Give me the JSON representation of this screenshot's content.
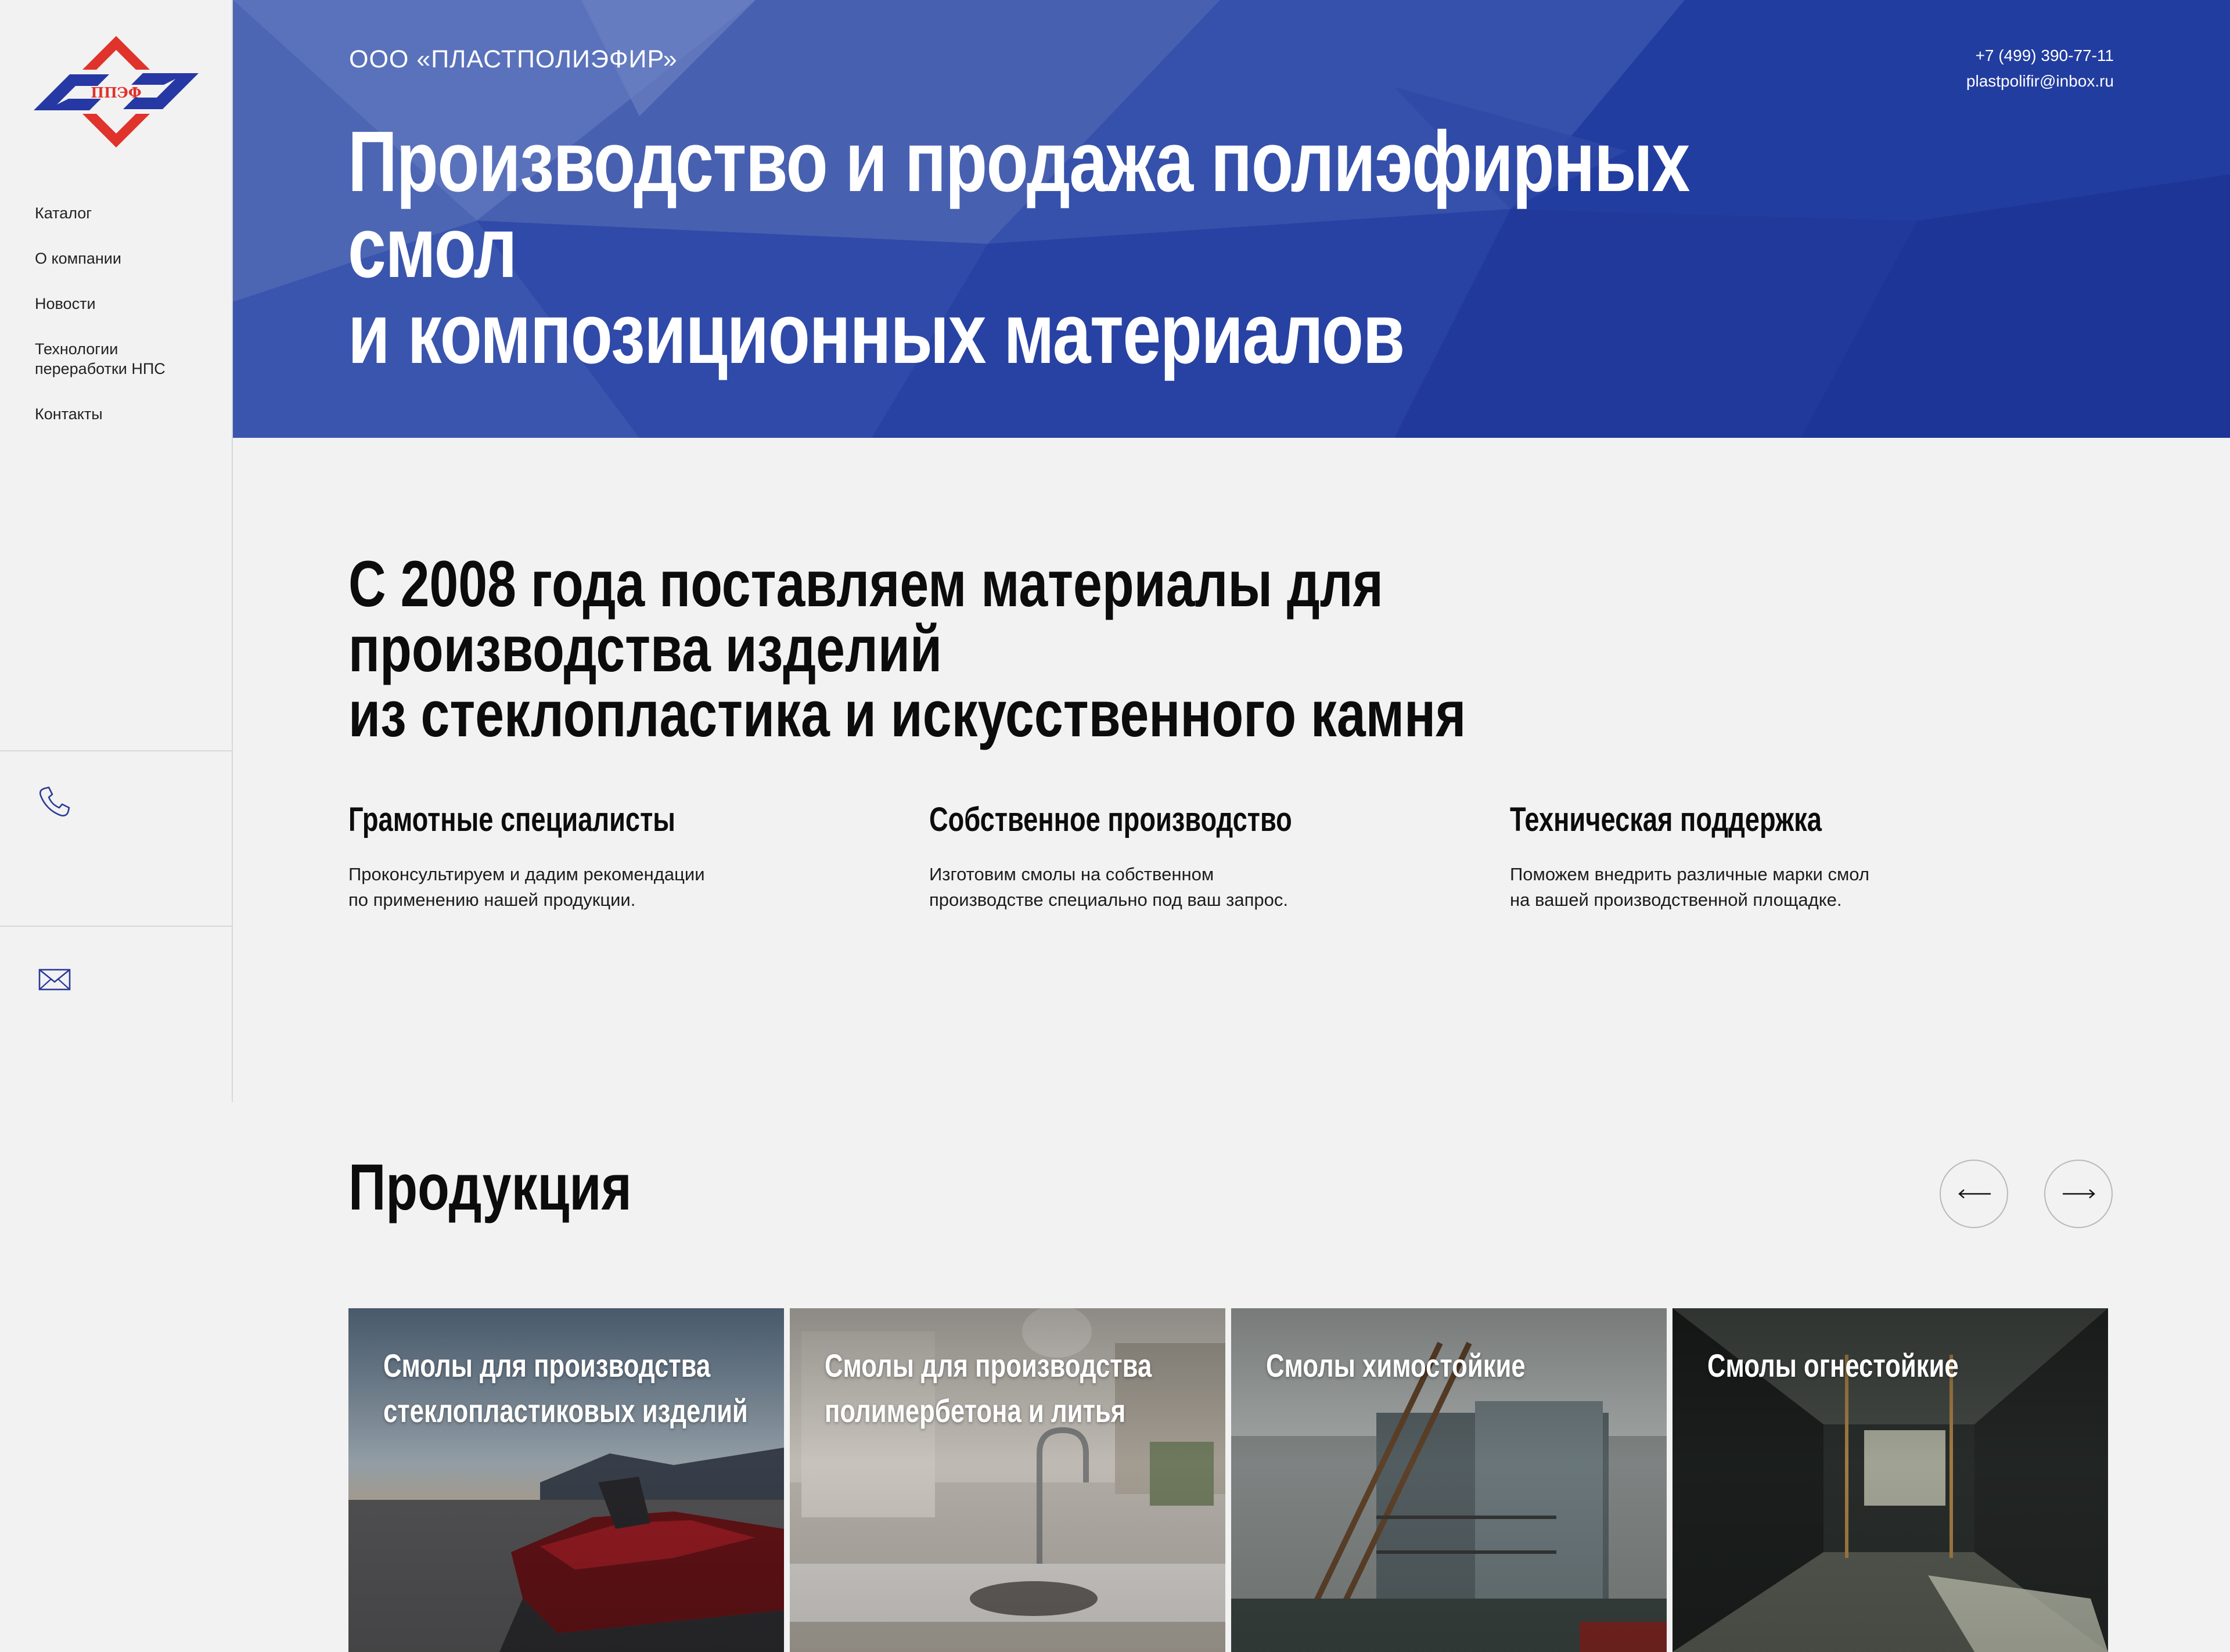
{
  "brand": {
    "logo_text": "ППЭФ",
    "colors": {
      "red": "#e0332b",
      "blue": "#2638a4"
    }
  },
  "sidebar": {
    "nav": [
      {
        "label": "Каталог"
      },
      {
        "label": "О компании"
      },
      {
        "label": "Новости"
      },
      {
        "label": "Технологии переработки НПС"
      },
      {
        "label": "Контакты"
      }
    ],
    "icons": {
      "phone": "phone-icon",
      "mail": "mail-icon"
    }
  },
  "hero": {
    "company": "ООО «ПЛАСТПОЛИЭФИР»",
    "phone": "+7 (499) 390-77-11",
    "email": "plastpolifir@inbox.ru",
    "title_line1": "Производство и продажа полиэфирных смол",
    "title_line2": "и композиционных материалов",
    "background_color": "#2a44a8"
  },
  "about": {
    "subtitle_line1": "С 2008 года поставляем материалы для производства изделий",
    "subtitle_line2": "из стеклопластика и искусственного камня"
  },
  "features": [
    {
      "title": "Грамотные специалисты",
      "line1": "Проконсультируем и дадим рекомендации",
      "line2": "по применению нашей продукции."
    },
    {
      "title": "Собственное производство",
      "line1": "Изготовим смолы на собственном",
      "line2": "производстве специально под ваш запрос."
    },
    {
      "title": "Техническая поддержка",
      "line1": "Поможем внедрить различные марки смол",
      "line2": "на вашей производственной площадке."
    }
  ],
  "products": {
    "title": "Продукция",
    "prev_icon": "arrow-left-icon",
    "next_icon": "arrow-right-icon",
    "cards": [
      {
        "line1": "Смолы для производства",
        "line2": "стеклопластиковых изделий"
      },
      {
        "line1": "Смолы для производства",
        "line2": "полимербетона и литья"
      },
      {
        "line1": "Смолы химостойкие",
        "line2": ""
      },
      {
        "line1": "Смолы огнестойкие",
        "line2": ""
      }
    ]
  }
}
